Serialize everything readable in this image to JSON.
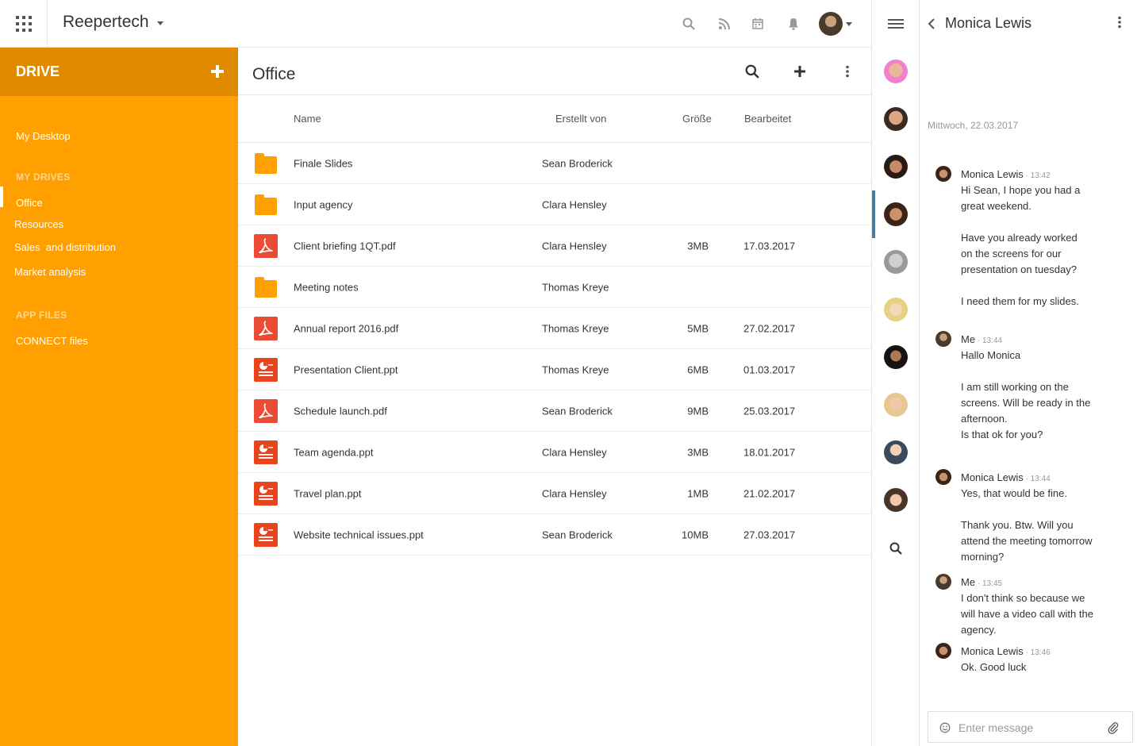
{
  "topbar": {
    "brand": "Reepertech",
    "icons": [
      "search-icon",
      "rss-icon",
      "calendar-icon",
      "bell-icon"
    ]
  },
  "sidebar": {
    "title": "DRIVE",
    "desktop": "My Desktop",
    "my_drives_label": "MY DRIVES",
    "drives": [
      "Office",
      "Resources",
      "Sales  and distribution",
      "Market analysis"
    ],
    "app_files_label": "APP FILES",
    "app_files": [
      "CONNECT files"
    ],
    "active": "Office"
  },
  "main": {
    "title": "Office",
    "columns": {
      "name": "Name",
      "created_by": "Erstellt von",
      "size": "Größe",
      "edited": "Bearbeitet"
    },
    "files": [
      {
        "type": "folder",
        "name": "Finale Slides",
        "created_by": "Sean Broderick",
        "size": "",
        "edited": ""
      },
      {
        "type": "folder",
        "name": "Input agency",
        "created_by": "Clara Hensley",
        "size": "",
        "edited": ""
      },
      {
        "type": "pdf",
        "name": "Client briefing 1QT.pdf",
        "created_by": "Clara Hensley",
        "size": "3MB",
        "edited": "17.03.2017"
      },
      {
        "type": "folder",
        "name": "Meeting notes",
        "created_by": "Thomas Kreye",
        "size": "",
        "edited": ""
      },
      {
        "type": "pdf",
        "name": "Annual report 2016.pdf",
        "created_by": "Thomas Kreye",
        "size": "5MB",
        "edited": "27.02.2017"
      },
      {
        "type": "ppt",
        "name": "Presentation Client.ppt",
        "created_by": "Thomas Kreye",
        "size": "6MB",
        "edited": "01.03.2017"
      },
      {
        "type": "pdf",
        "name": "Schedule launch.pdf",
        "created_by": "Sean Broderick",
        "size": "9MB",
        "edited": "25.03.2017"
      },
      {
        "type": "ppt",
        "name": "Team agenda.ppt",
        "created_by": "Clara Hensley",
        "size": "3MB",
        "edited": "18.01.2017"
      },
      {
        "type": "ppt",
        "name": "Travel plan.ppt",
        "created_by": "Clara Hensley",
        "size": "1MB",
        "edited": "21.02.2017"
      },
      {
        "type": "ppt",
        "name": "Website technical issues.ppt",
        "created_by": "Sean Broderick",
        "size": "10MB",
        "edited": "27.03.2017"
      }
    ]
  },
  "chat": {
    "contact_name": "Monica Lewis",
    "date": "Mittwoch, 22.03.2017",
    "messages": [
      {
        "author": "Monica Lewis",
        "time": "13:42",
        "lines": [
          "Hi Sean, I hope you had a",
          "great weekend.",
          "",
          "Have you already worked",
          "on the screens for our",
          "presentation on tuesday?",
          "",
          "I need them for my slides."
        ]
      },
      {
        "author": "Me",
        "time": "13:44",
        "lines": [
          "Hallo Monica",
          "",
          "I am still working on the",
          "screens. Will be ready in the",
          "afternoon.",
          "Is that ok for you?"
        ]
      },
      {
        "author": "Monica Lewis",
        "time": "13:44",
        "lines": [
          "Yes, that would be fine.",
          "",
          "Thank you. Btw. Will you",
          "attend the meeting tomorrow",
          "morning?"
        ]
      },
      {
        "author": "Me",
        "time": "13:45",
        "lines": [
          "I don't think so because we",
          "will have a video call with the",
          "agency."
        ]
      },
      {
        "author": "Monica Lewis",
        "time": "13:46",
        "lines": [
          "Ok. Good luck"
        ]
      }
    ],
    "input_placeholder": "Enter message"
  },
  "colors": {
    "accent": "#ffa000",
    "accent_dark": "#e08a00",
    "pdf": "#e94b35",
    "ppt": "#e8451e",
    "rail_active": "#4a7a9c"
  }
}
